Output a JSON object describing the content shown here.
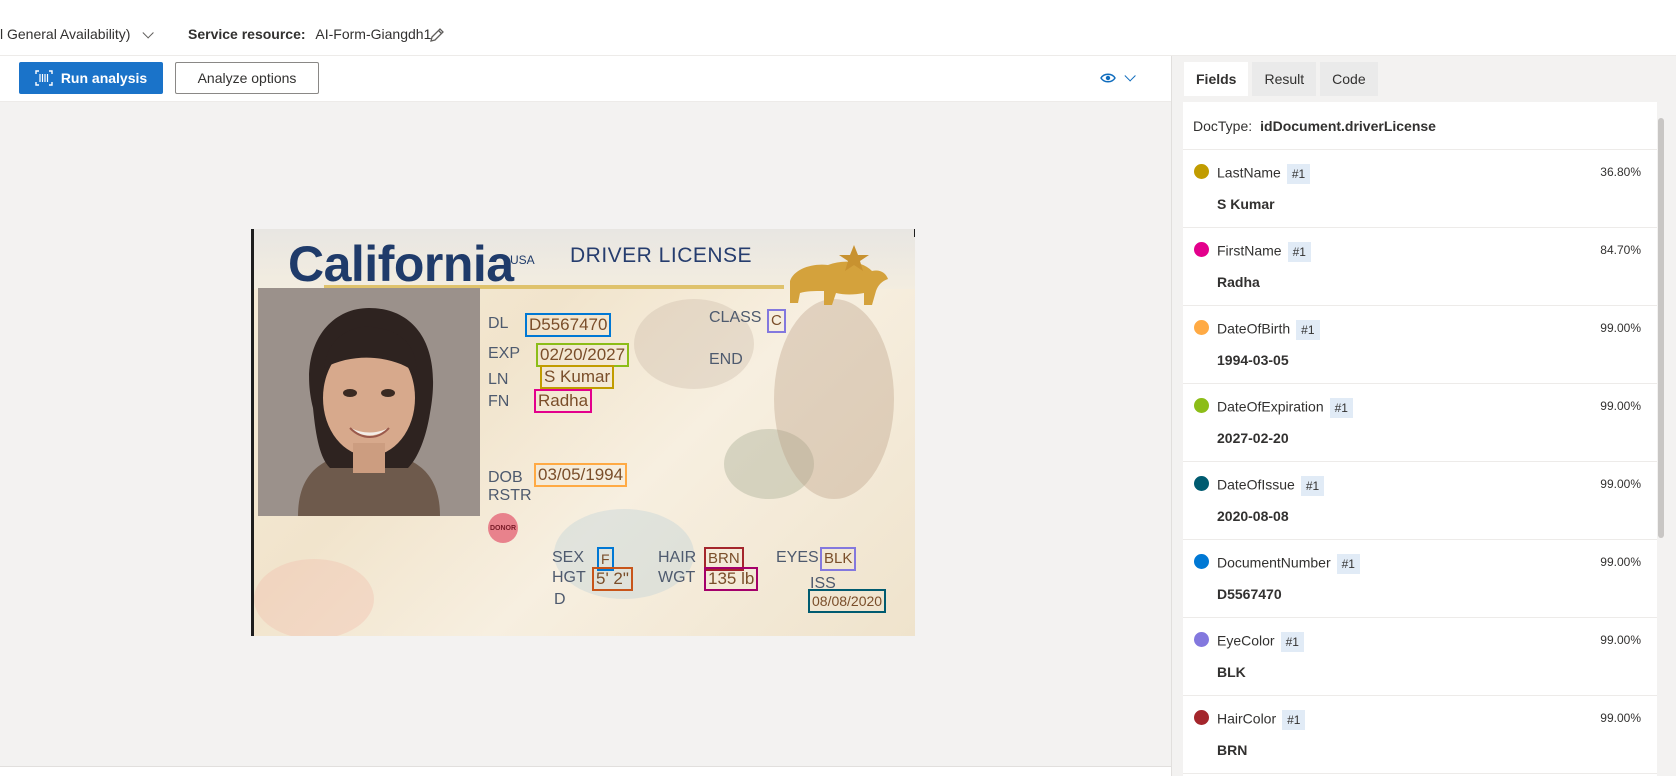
{
  "header": {
    "api_version": "l General Availability)",
    "service_resource_label": "Service resource:",
    "service_resource_value": "AI-Form-Giangdh1"
  },
  "toolbar": {
    "run_label": "Run analysis",
    "analyze_options_label": "Analyze options"
  },
  "card": {
    "title": "California",
    "country": "USA",
    "doc_title": "DRIVER LICENSE",
    "labels": {
      "dl": "DL",
      "exp": "EXP",
      "ln": "LN",
      "fn": "FN",
      "dob": "DOB",
      "rstr": "RSTR",
      "class": "CLASS",
      "end": "END",
      "sex": "SEX",
      "hgt": "HGT",
      "hair": "HAIR",
      "wgt": "WGT",
      "eyes": "EYES",
      "iss": "ISS",
      "d": "D",
      "donor": "DONOR"
    },
    "values": {
      "dl": "D5567470",
      "exp": "02/20/2027",
      "ln": "S Kumar",
      "fn": "Radha",
      "dob": "03/05/1994",
      "class": "C",
      "sex": "F",
      "hgt": "5' 2\"",
      "hair": "BRN",
      "wgt": "135 lb",
      "eyes": "BLK",
      "iss": "08/08/2020"
    }
  },
  "right_panel": {
    "tabs": [
      "Fields",
      "Result",
      "Code"
    ],
    "active_tab": "Fields",
    "doctype_label": "DocType:",
    "doctype_value": "idDocument.driverLicense",
    "fields": [
      {
        "name": "LastName",
        "badge": "#1",
        "confidence": "36.80%",
        "value": "S Kumar",
        "color": "#c19c00"
      },
      {
        "name": "FirstName",
        "badge": "#1",
        "confidence": "84.70%",
        "value": "Radha",
        "color": "#e3008c"
      },
      {
        "name": "DateOfBirth",
        "badge": "#1",
        "confidence": "99.00%",
        "value": "1994-03-05",
        "color": "#ffaa44"
      },
      {
        "name": "DateOfExpiration",
        "badge": "#1",
        "confidence": "99.00%",
        "value": "2027-02-20",
        "color": "#8cbd18"
      },
      {
        "name": "DateOfIssue",
        "badge": "#1",
        "confidence": "99.00%",
        "value": "2020-08-08",
        "color": "#005b70"
      },
      {
        "name": "DocumentNumber",
        "badge": "#1",
        "confidence": "99.00%",
        "value": "D5567470",
        "color": "#0078d4"
      },
      {
        "name": "EyeColor",
        "badge": "#1",
        "confidence": "99.00%",
        "value": "BLK",
        "color": "#8378de"
      },
      {
        "name": "HairColor",
        "badge": "#1",
        "confidence": "99.00%",
        "value": "BRN",
        "color": "#a4262c"
      }
    ]
  }
}
